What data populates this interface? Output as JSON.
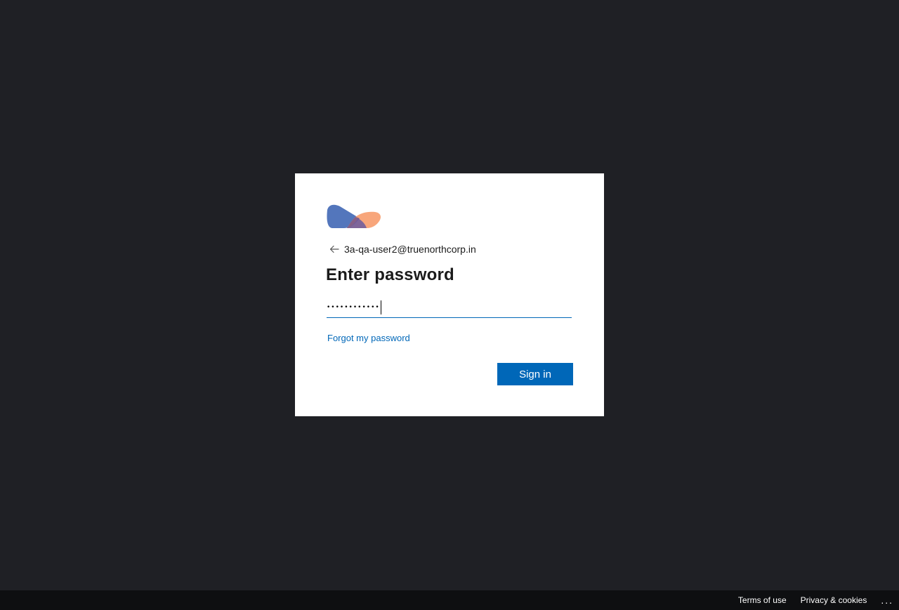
{
  "signin": {
    "identity": "3a-qa-user2@truenorthcorp.in",
    "title": "Enter password",
    "password_masked": "••••••••••••",
    "forgot_label": "Forgot my password",
    "submit_label": "Sign in",
    "accent_color": "#0067b8",
    "logo_icon": "brand-logo-icon",
    "back_icon": "back-arrow-icon"
  },
  "footer": {
    "terms_label": "Terms of use",
    "privacy_label": "Privacy & cookies",
    "more_label": "..."
  }
}
